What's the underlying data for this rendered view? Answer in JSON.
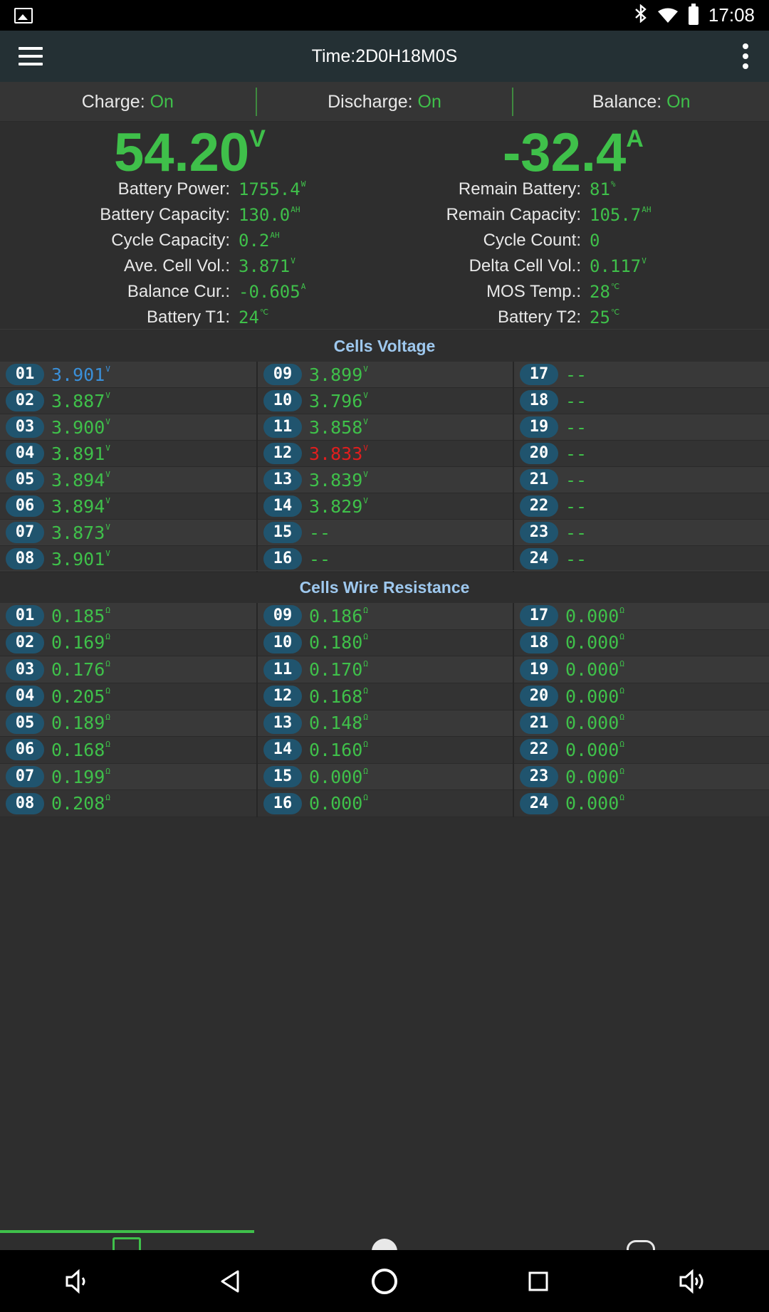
{
  "status_bar": {
    "time": "17:08"
  },
  "toolbar": {
    "title": "Time:2D0H18M0S"
  },
  "status": {
    "charge_label": "Charge: ",
    "charge_value": "On",
    "discharge_label": "Discharge: ",
    "discharge_value": "On",
    "balance_label": "Balance: ",
    "balance_value": "On"
  },
  "main": {
    "voltage": "54.20",
    "voltage_unit": "V",
    "current": "-32.4",
    "current_unit": "A"
  },
  "info_left": [
    {
      "label": "Battery Power:",
      "value": "1755.4",
      "unit": "W"
    },
    {
      "label": "Battery Capacity:",
      "value": "130.0",
      "unit": "AH"
    },
    {
      "label": "Cycle Capacity:",
      "value": "0.2",
      "unit": "AH"
    },
    {
      "label": "Ave. Cell Vol.:",
      "value": "3.871",
      "unit": "V"
    },
    {
      "label": "Balance Cur.:",
      "value": "-0.605",
      "unit": "A"
    },
    {
      "label": "Battery T1:",
      "value": "24",
      "unit": "℃"
    }
  ],
  "info_right": [
    {
      "label": "Remain Battery:",
      "value": "81",
      "unit": "%"
    },
    {
      "label": "Remain Capacity:",
      "value": "105.7",
      "unit": "AH"
    },
    {
      "label": "Cycle Count:",
      "value": "0",
      "unit": ""
    },
    {
      "label": "Delta Cell Vol.:",
      "value": "0.117",
      "unit": "V"
    },
    {
      "label": "MOS Temp.:",
      "value": "28",
      "unit": "℃"
    },
    {
      "label": "Battery T2:",
      "value": "25",
      "unit": "℃"
    }
  ],
  "cells_voltage": {
    "title": "Cells Voltage",
    "unit": "V",
    "cells": [
      {
        "id": "01",
        "value": "3.901",
        "state": "min"
      },
      {
        "id": "02",
        "value": "3.887",
        "state": ""
      },
      {
        "id": "03",
        "value": "3.900",
        "state": ""
      },
      {
        "id": "04",
        "value": "3.891",
        "state": ""
      },
      {
        "id": "05",
        "value": "3.894",
        "state": ""
      },
      {
        "id": "06",
        "value": "3.894",
        "state": ""
      },
      {
        "id": "07",
        "value": "3.873",
        "state": ""
      },
      {
        "id": "08",
        "value": "3.901",
        "state": ""
      },
      {
        "id": "09",
        "value": "3.899",
        "state": ""
      },
      {
        "id": "10",
        "value": "3.796",
        "state": ""
      },
      {
        "id": "11",
        "value": "3.858",
        "state": ""
      },
      {
        "id": "12",
        "value": "3.833",
        "state": "max"
      },
      {
        "id": "13",
        "value": "3.839",
        "state": ""
      },
      {
        "id": "14",
        "value": "3.829",
        "state": ""
      },
      {
        "id": "15",
        "value": "--",
        "state": ""
      },
      {
        "id": "16",
        "value": "--",
        "state": ""
      },
      {
        "id": "17",
        "value": "--",
        "state": ""
      },
      {
        "id": "18",
        "value": "--",
        "state": ""
      },
      {
        "id": "19",
        "value": "--",
        "state": ""
      },
      {
        "id": "20",
        "value": "--",
        "state": ""
      },
      {
        "id": "21",
        "value": "--",
        "state": ""
      },
      {
        "id": "22",
        "value": "--",
        "state": ""
      },
      {
        "id": "23",
        "value": "--",
        "state": ""
      },
      {
        "id": "24",
        "value": "--",
        "state": ""
      }
    ]
  },
  "cells_resistance": {
    "title": "Cells Wire Resistance",
    "unit": "Ω",
    "cells": [
      {
        "id": "01",
        "value": "0.185"
      },
      {
        "id": "02",
        "value": "0.169"
      },
      {
        "id": "03",
        "value": "0.176"
      },
      {
        "id": "04",
        "value": "0.205"
      },
      {
        "id": "05",
        "value": "0.189"
      },
      {
        "id": "06",
        "value": "0.168"
      },
      {
        "id": "07",
        "value": "0.199"
      },
      {
        "id": "08",
        "value": "0.208"
      },
      {
        "id": "09",
        "value": "0.186"
      },
      {
        "id": "10",
        "value": "0.180"
      },
      {
        "id": "11",
        "value": "0.170"
      },
      {
        "id": "12",
        "value": "0.168"
      },
      {
        "id": "13",
        "value": "0.148"
      },
      {
        "id": "14",
        "value": "0.160"
      },
      {
        "id": "15",
        "value": "0.000"
      },
      {
        "id": "16",
        "value": "0.000"
      },
      {
        "id": "17",
        "value": "0.000"
      },
      {
        "id": "18",
        "value": "0.000"
      },
      {
        "id": "19",
        "value": "0.000"
      },
      {
        "id": "20",
        "value": "0.000"
      },
      {
        "id": "21",
        "value": "0.000"
      },
      {
        "id": "22",
        "value": "0.000"
      },
      {
        "id": "23",
        "value": "0.000"
      },
      {
        "id": "24",
        "value": "0.000"
      }
    ]
  },
  "bottom_nav": {
    "tabs": [
      {
        "icon": "monitor-icon",
        "active": true
      },
      {
        "icon": "gear-icon",
        "active": false
      },
      {
        "icon": "toggle-icon",
        "active": false
      }
    ]
  },
  "colors": {
    "accent_green": "#3fc04a",
    "min_blue": "#3a8fd8",
    "max_red": "#e01e1e",
    "section_title": "#9ec8ee",
    "toolbar_bg": "#243034"
  }
}
